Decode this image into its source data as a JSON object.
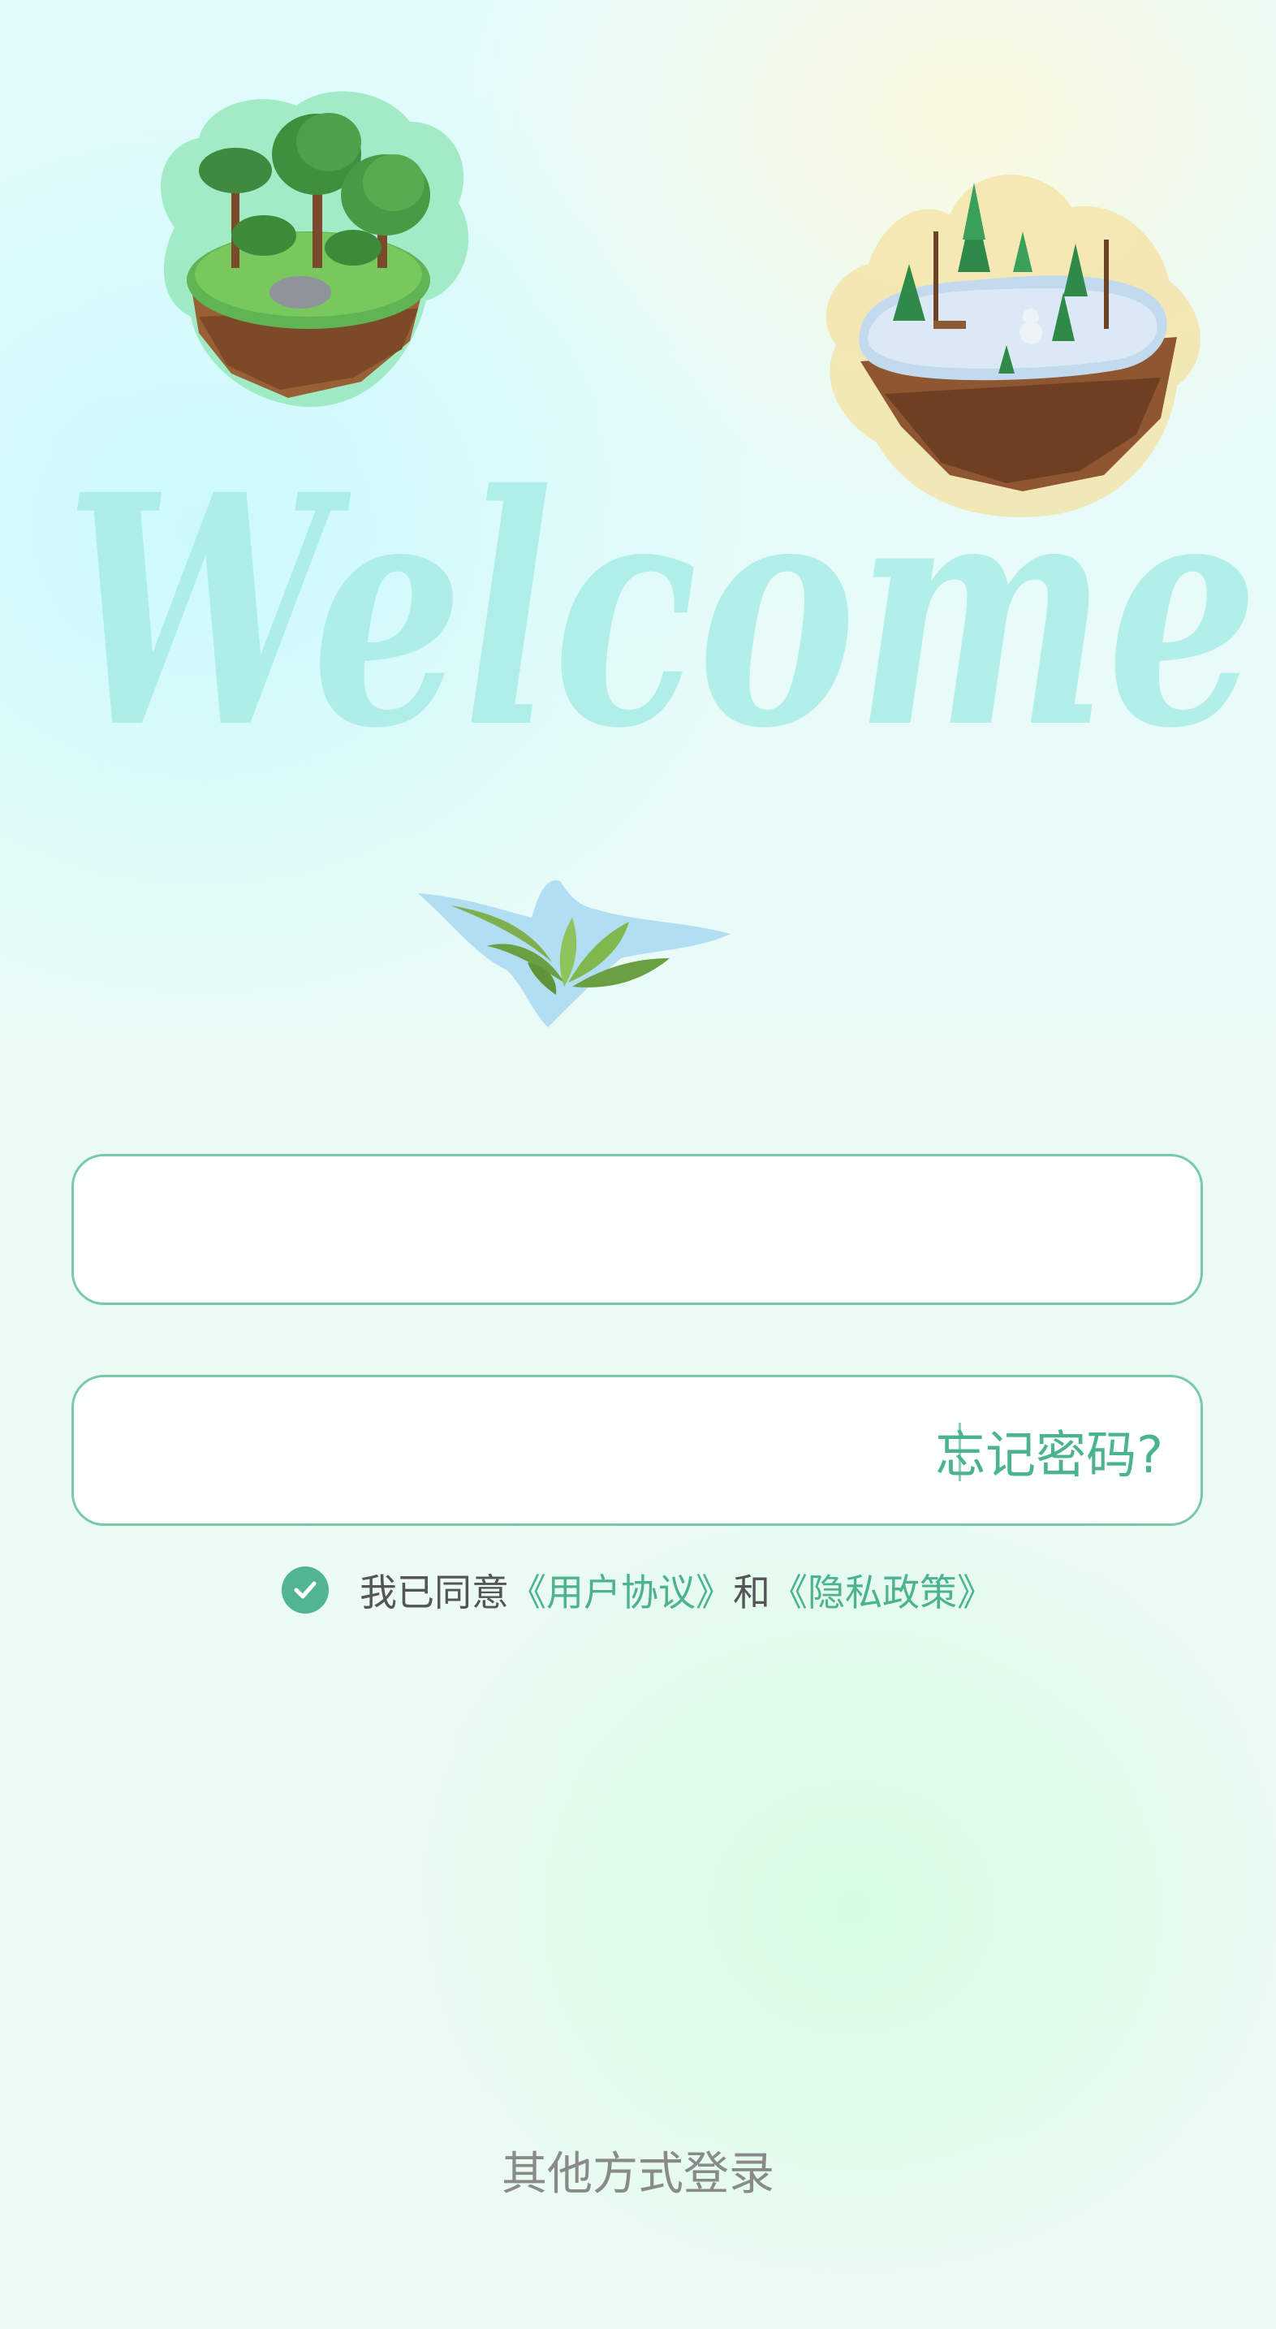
{
  "welcome": {
    "text": "Welcome",
    "color": "#a8ede6"
  },
  "login_form": {
    "account_placeholder": "",
    "password_placeholder": "",
    "forgot_label": "忘记密码?",
    "border_color": "#79c9a9",
    "accent_color": "#4cb391"
  },
  "agreement": {
    "checked": true,
    "prefix": "我已同意",
    "user_agreement": "《用户协议》",
    "and": "和",
    "privacy_policy": "《隐私政策》"
  },
  "other_login": {
    "label": "其他方式登录"
  },
  "decorations": {
    "island_forest": "floating-forest-island-illustration",
    "island_snow": "floating-snow-island-illustration",
    "plant": "small-plant-illustration"
  }
}
